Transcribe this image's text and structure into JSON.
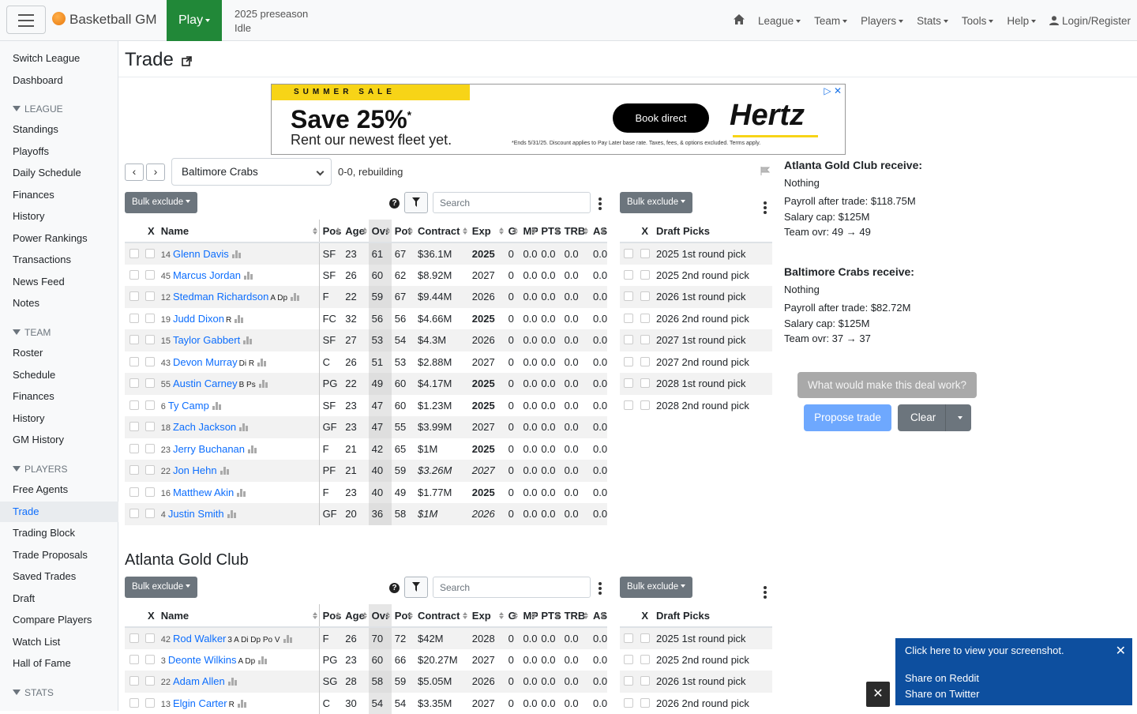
{
  "nav": {
    "brand": "Basketball GM",
    "play": "Play",
    "season": "2025 preseason",
    "status": "Idle",
    "menu": [
      "League",
      "Team",
      "Players",
      "Stats",
      "Tools",
      "Help"
    ],
    "login": "Login/Register"
  },
  "sidebar": {
    "top": [
      "Switch League",
      "Dashboard"
    ],
    "league_head": "LEAGUE",
    "league": [
      "Standings",
      "Playoffs",
      "Daily Schedule",
      "Finances",
      "History",
      "Power Rankings",
      "Transactions",
      "News Feed",
      "Notes"
    ],
    "team_head": "TEAM",
    "team": [
      "Roster",
      "Schedule",
      "Finances",
      "History",
      "GM History"
    ],
    "players_head": "PLAYERS",
    "players": [
      "Free Agents",
      "Trade",
      "Trading Block",
      "Trade Proposals",
      "Saved Trades",
      "Draft",
      "Compare Players",
      "Watch List",
      "Hall of Fame"
    ],
    "stats_head": "STATS",
    "active": "Trade"
  },
  "page": {
    "title": "Trade"
  },
  "ad": {
    "band": "SUMMER SALE",
    "headline": "Save 25%",
    "sup": "*",
    "sub": "Rent our newest fleet yet.",
    "button": "Book direct",
    "logo": "Hertz",
    "fine": "*Ends 5/31/25. Discount applies to Pay Later base rate. Taxes, fees, & options excluded. Terms apply."
  },
  "team_select": {
    "value": "Baltimore Crabs",
    "record": "0-0, rebuilding"
  },
  "controls": {
    "bulk": "Bulk exclude",
    "search_placeholder": "Search"
  },
  "roster_headers": [
    "X",
    "Name",
    "Pos",
    "Age",
    "Ovr",
    "Pot",
    "Contract",
    "Exp",
    "G",
    "MP",
    "PTS",
    "TRB",
    "AST"
  ],
  "picks_headers": [
    "X",
    "Draft Picks"
  ],
  "other_team_roster": [
    {
      "num": "14",
      "name": "Glenn Davis",
      "skills": "",
      "pos": "SF",
      "age": "23",
      "ovr": "61",
      "pot": "67",
      "contract": "$36.1M",
      "exp": "2025",
      "g": "0",
      "mp": "0.0",
      "pts": "0.0",
      "trb": "0.0",
      "ast": "0.0",
      "bold_exp": true,
      "italic": false
    },
    {
      "num": "45",
      "name": "Marcus Jordan",
      "skills": "",
      "pos": "SF",
      "age": "26",
      "ovr": "60",
      "pot": "62",
      "contract": "$8.92M",
      "exp": "2027",
      "g": "0",
      "mp": "0.0",
      "pts": "0.0",
      "trb": "0.0",
      "ast": "0.0",
      "bold_exp": false,
      "italic": false
    },
    {
      "num": "12",
      "name": "Stedman Richardson",
      "skills": "A Dp",
      "pos": "F",
      "age": "22",
      "ovr": "59",
      "pot": "67",
      "contract": "$9.44M",
      "exp": "2026",
      "g": "0",
      "mp": "0.0",
      "pts": "0.0",
      "trb": "0.0",
      "ast": "0.0",
      "bold_exp": false,
      "italic": false
    },
    {
      "num": "19",
      "name": "Judd Dixon",
      "skills": "R",
      "pos": "FC",
      "age": "32",
      "ovr": "56",
      "pot": "56",
      "contract": "$4.66M",
      "exp": "2025",
      "g": "0",
      "mp": "0.0",
      "pts": "0.0",
      "trb": "0.0",
      "ast": "0.0",
      "bold_exp": true,
      "italic": false
    },
    {
      "num": "15",
      "name": "Taylor Gabbert",
      "skills": "",
      "pos": "SF",
      "age": "27",
      "ovr": "53",
      "pot": "54",
      "contract": "$4.3M",
      "exp": "2026",
      "g": "0",
      "mp": "0.0",
      "pts": "0.0",
      "trb": "0.0",
      "ast": "0.0",
      "bold_exp": false,
      "italic": false
    },
    {
      "num": "43",
      "name": "Devon Murray",
      "skills": "Di R",
      "pos": "C",
      "age": "26",
      "ovr": "51",
      "pot": "53",
      "contract": "$2.88M",
      "exp": "2027",
      "g": "0",
      "mp": "0.0",
      "pts": "0.0",
      "trb": "0.0",
      "ast": "0.0",
      "bold_exp": false,
      "italic": false
    },
    {
      "num": "55",
      "name": "Austin Carney",
      "skills": "B Ps",
      "pos": "PG",
      "age": "22",
      "ovr": "49",
      "pot": "60",
      "contract": "$4.17M",
      "exp": "2025",
      "g": "0",
      "mp": "0.0",
      "pts": "0.0",
      "trb": "0.0",
      "ast": "0.0",
      "bold_exp": true,
      "italic": false
    },
    {
      "num": "6",
      "name": "Ty Camp",
      "skills": "",
      "pos": "SF",
      "age": "23",
      "ovr": "47",
      "pot": "60",
      "contract": "$1.23M",
      "exp": "2025",
      "g": "0",
      "mp": "0.0",
      "pts": "0.0",
      "trb": "0.0",
      "ast": "0.0",
      "bold_exp": true,
      "italic": false
    },
    {
      "num": "18",
      "name": "Zach Jackson",
      "skills": "",
      "pos": "GF",
      "age": "23",
      "ovr": "47",
      "pot": "55",
      "contract": "$3.99M",
      "exp": "2027",
      "g": "0",
      "mp": "0.0",
      "pts": "0.0",
      "trb": "0.0",
      "ast": "0.0",
      "bold_exp": false,
      "italic": false
    },
    {
      "num": "23",
      "name": "Jerry Buchanan",
      "skills": "",
      "pos": "F",
      "age": "21",
      "ovr": "42",
      "pot": "65",
      "contract": "$1M",
      "exp": "2025",
      "g": "0",
      "mp": "0.0",
      "pts": "0.0",
      "trb": "0.0",
      "ast": "0.0",
      "bold_exp": true,
      "italic": false
    },
    {
      "num": "22",
      "name": "Jon Hehn",
      "skills": "",
      "pos": "PF",
      "age": "21",
      "ovr": "40",
      "pot": "59",
      "contract": "$3.26M",
      "exp": "2027",
      "g": "0",
      "mp": "0.0",
      "pts": "0.0",
      "trb": "0.0",
      "ast": "0.0",
      "bold_exp": false,
      "italic": true
    },
    {
      "num": "16",
      "name": "Matthew Akin",
      "skills": "",
      "pos": "F",
      "age": "23",
      "ovr": "40",
      "pot": "49",
      "contract": "$1.77M",
      "exp": "2025",
      "g": "0",
      "mp": "0.0",
      "pts": "0.0",
      "trb": "0.0",
      "ast": "0.0",
      "bold_exp": true,
      "italic": false
    },
    {
      "num": "4",
      "name": "Justin Smith",
      "skills": "",
      "pos": "GF",
      "age": "20",
      "ovr": "36",
      "pot": "58",
      "contract": "$1M",
      "exp": "2026",
      "g": "0",
      "mp": "0.0",
      "pts": "0.0",
      "trb": "0.0",
      "ast": "0.0",
      "bold_exp": false,
      "italic": true
    }
  ],
  "other_team_picks": [
    "2025 1st round pick",
    "2025 2nd round pick",
    "2026 1st round pick",
    "2026 2nd round pick",
    "2027 1st round pick",
    "2027 2nd round pick",
    "2028 1st round pick",
    "2028 2nd round pick"
  ],
  "user_team_name": "Atlanta Gold Club",
  "user_team_roster": [
    {
      "num": "42",
      "name": "Rod Walker",
      "skills": "3 A Di Dp Po V",
      "pos": "F",
      "age": "26",
      "ovr": "70",
      "pot": "72",
      "contract": "$42M",
      "exp": "2028",
      "g": "0",
      "mp": "0.0",
      "pts": "0.0",
      "trb": "0.0",
      "ast": "0.0",
      "bold_exp": false,
      "italic": false
    },
    {
      "num": "3",
      "name": "Deonte Wilkins",
      "skills": "A Dp",
      "pos": "PG",
      "age": "23",
      "ovr": "60",
      "pot": "66",
      "contract": "$20.27M",
      "exp": "2027",
      "g": "0",
      "mp": "0.0",
      "pts": "0.0",
      "trb": "0.0",
      "ast": "0.0",
      "bold_exp": false,
      "italic": false
    },
    {
      "num": "22",
      "name": "Adam Allen",
      "skills": "",
      "pos": "SG",
      "age": "28",
      "ovr": "58",
      "pot": "59",
      "contract": "$5.05M",
      "exp": "2026",
      "g": "0",
      "mp": "0.0",
      "pts": "0.0",
      "trb": "0.0",
      "ast": "0.0",
      "bold_exp": false,
      "italic": false
    },
    {
      "num": "13",
      "name": "Elgin Carter",
      "skills": "R",
      "pos": "C",
      "age": "30",
      "ovr": "54",
      "pot": "54",
      "contract": "$3.35M",
      "exp": "2027",
      "g": "0",
      "mp": "0.0",
      "pts": "0.0",
      "trb": "0.0",
      "ast": "0.0",
      "bold_exp": false,
      "italic": false
    }
  ],
  "user_team_picks": [
    "2025 1st round pick",
    "2025 2nd round pick",
    "2026 1st round pick",
    "2026 2nd round pick"
  ],
  "summary": {
    "a_head": "Atlanta Gold Club receive:",
    "a_items": "Nothing",
    "a_payroll": "Payroll after trade: $118.75M",
    "a_cap": "Salary cap: $125M",
    "a_ovr": "Team ovr: 49 → 49",
    "b_head": "Baltimore Crabs receive:",
    "b_items": "Nothing",
    "b_payroll": "Payroll after trade: $82.72M",
    "b_cap": "Salary cap: $125M",
    "b_ovr": "Team ovr: 37 → 37",
    "what_button": "What would make this deal work?",
    "propose_button": "Propose trade",
    "clear_button": "Clear"
  },
  "toast": {
    "line1": "Click here to view your screenshot.",
    "reddit": "Share on Reddit",
    "twitter": "Share on Twitter"
  },
  "colors": {
    "play": "#218838",
    "link": "#0d6efd",
    "toast": "#0d4f9f",
    "propose": "#6ea8fe"
  }
}
